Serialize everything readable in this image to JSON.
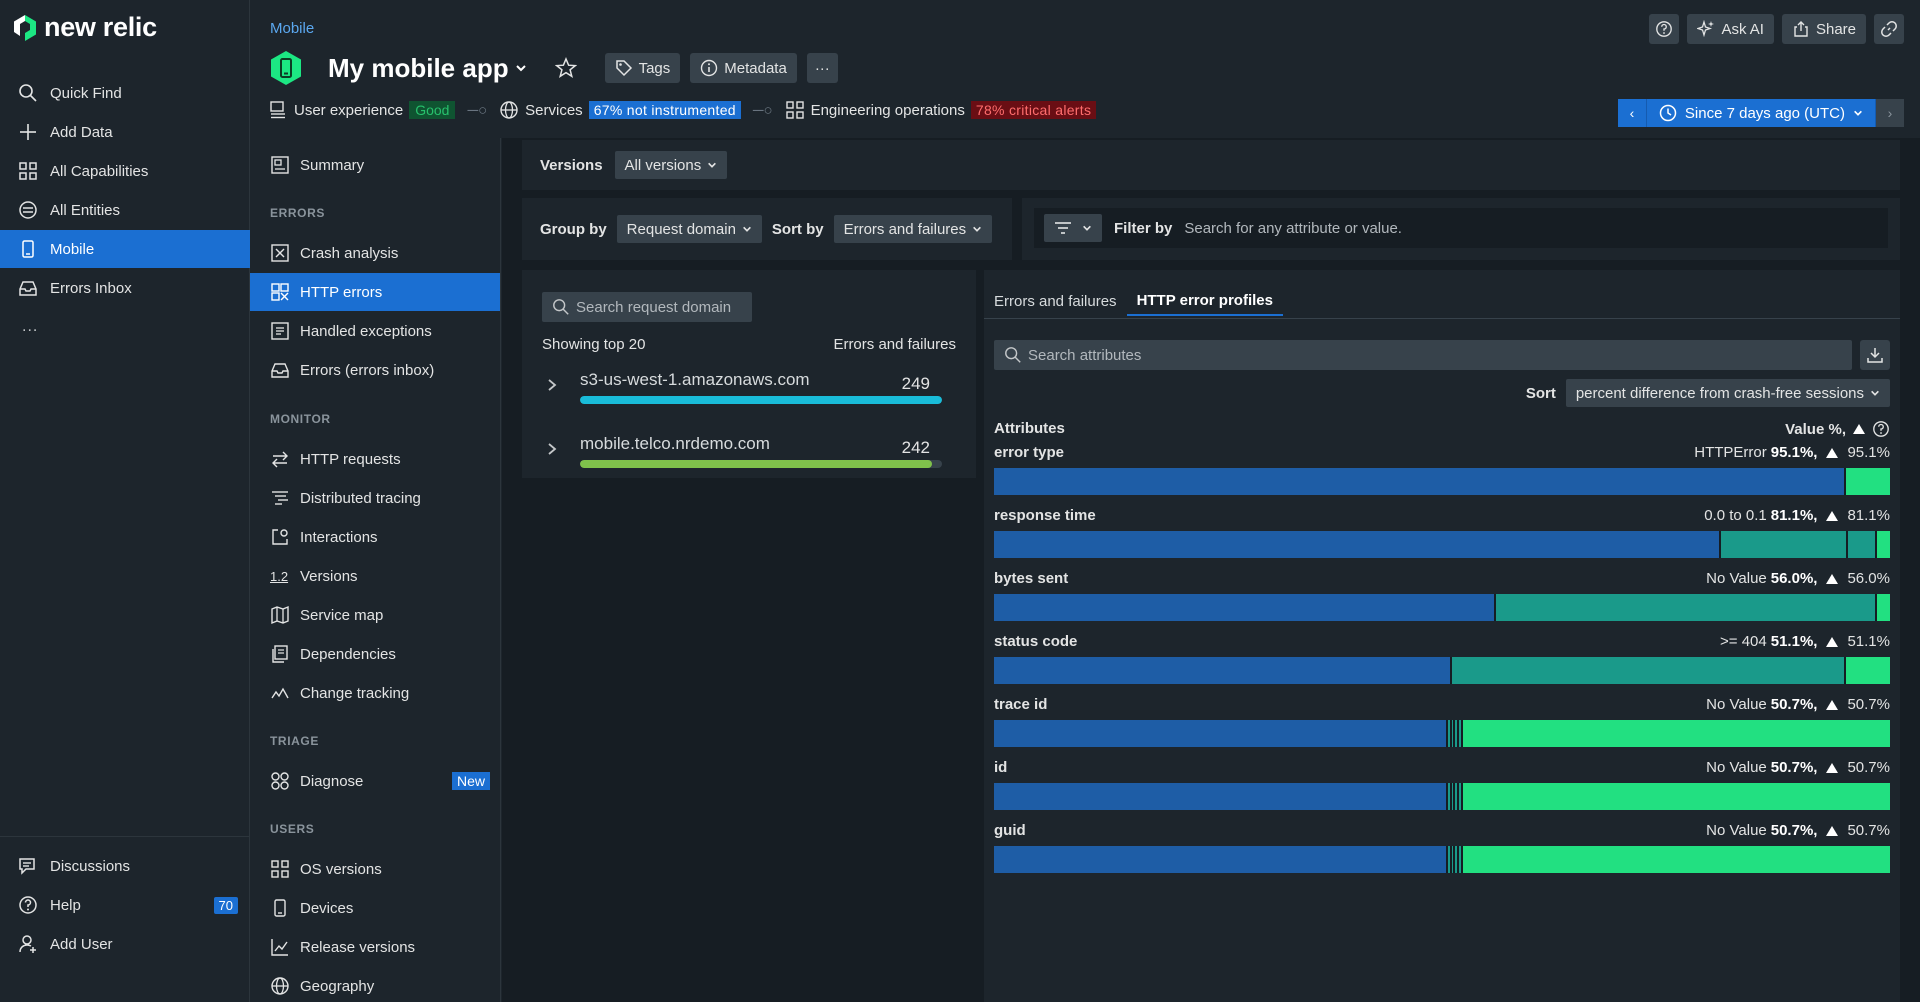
{
  "brand": {
    "name": "new relic"
  },
  "leftnav": {
    "items": [
      {
        "label": "Quick Find",
        "icon": "search-icon"
      },
      {
        "label": "Add Data",
        "icon": "plus-icon"
      },
      {
        "label": "All Capabilities",
        "icon": "grid-icon"
      },
      {
        "label": "All Entities",
        "icon": "entities-icon"
      },
      {
        "label": "Mobile",
        "icon": "mobile-icon"
      },
      {
        "label": "Errors Inbox",
        "icon": "inbox-icon"
      }
    ],
    "more": "...",
    "bottom": [
      {
        "label": "Discussions",
        "icon": "discussions-icon"
      },
      {
        "label": "Help",
        "icon": "help-icon",
        "count": "70"
      },
      {
        "label": "Add User",
        "icon": "add-user-icon"
      }
    ]
  },
  "header": {
    "breadcrumb": "Mobile",
    "title": "My mobile app",
    "tags_label": "Tags",
    "metadata_label": "Metadata",
    "more_label": "···",
    "ask_ai_label": "Ask AI",
    "share_label": "Share"
  },
  "status": {
    "user_experience": {
      "label": "User experience",
      "value": "Good"
    },
    "services": {
      "label": "Services",
      "value": "67% not instrumented"
    },
    "engineering": {
      "label": "Engineering operations",
      "value": "78% critical alerts"
    }
  },
  "time_picker": {
    "label": "Since 7 days ago (UTC)"
  },
  "subnav": {
    "summary": "Summary",
    "sections": [
      {
        "heading": "ERRORS",
        "items": [
          "Crash analysis",
          "HTTP errors",
          "Handled exceptions",
          "Errors (errors inbox)"
        ]
      },
      {
        "heading": "MONITOR",
        "items": [
          "HTTP requests",
          "Distributed tracing",
          "Interactions",
          "Versions",
          "Service map",
          "Dependencies",
          "Change tracking"
        ]
      },
      {
        "heading": "TRIAGE",
        "items": [
          "Diagnose"
        ]
      },
      {
        "heading": "USERS",
        "items": [
          "OS versions",
          "Devices",
          "Release versions",
          "Geography"
        ]
      }
    ],
    "new_badge": "New"
  },
  "versions_bar": {
    "label": "Versions",
    "value": "All versions"
  },
  "controls": {
    "group_by_label": "Group by",
    "group_by_value": "Request domain",
    "sort_by_label": "Sort by",
    "sort_by_value": "Errors and failures",
    "filter_label": "Filter by",
    "filter_placeholder": "Search for any attribute or value."
  },
  "domains": {
    "search_placeholder": "Search request domain",
    "showing": "Showing top 20",
    "column": "Errors and failures",
    "rows": [
      {
        "name": "s3-us-west-1.amazonaws.com",
        "value": "249",
        "fraction": 1.0,
        "color": "#19bcd9"
      },
      {
        "name": "mobile.telco.nrdemo.com",
        "value": "242",
        "fraction": 0.972,
        "color": "#7fc14b"
      }
    ]
  },
  "profiles": {
    "tabs": [
      "Errors and failures",
      "HTTP error profiles"
    ],
    "search_placeholder": "Search attributes",
    "sort_label": "Sort",
    "sort_value": "percent difference from crash-free sessions",
    "attributes_header": "Attributes",
    "value_header": "Value %,",
    "rows": [
      {
        "name": "error type",
        "value": "HTTPError",
        "pct": "95.1%,",
        "delta": "95.1%",
        "segments": [
          0.951,
          0.049
        ]
      },
      {
        "name": "response time",
        "value": "0.0 to 0.1",
        "pct": "81.1%,",
        "delta": "81.1%",
        "segments": [
          0.811,
          0.142,
          0.033,
          0.014
        ]
      },
      {
        "name": "bytes sent",
        "value": "No Value",
        "pct": "56.0%,",
        "delta": "56.0%",
        "segments": [
          0.56,
          0.425,
          0.015
        ]
      },
      {
        "name": "status code",
        "value": ">= 404",
        "pct": "51.1%,",
        "delta": "51.1%",
        "segments": [
          0.511,
          0.44,
          0.049
        ]
      },
      {
        "name": "trace id",
        "value": "No Value",
        "pct": "50.7%,",
        "delta": "50.7%",
        "segments": [
          0.507,
          0.004,
          0.004,
          0.004,
          0.004,
          0.477
        ]
      },
      {
        "name": "id",
        "value": "No Value",
        "pct": "50.7%,",
        "delta": "50.7%",
        "segments": [
          0.507,
          0.004,
          0.004,
          0.004,
          0.004,
          0.477
        ]
      },
      {
        "name": "guid",
        "value": "No Value",
        "pct": "50.7%,",
        "delta": "50.7%",
        "segments": [
          0.507,
          0.004,
          0.004,
          0.004,
          0.004,
          0.477
        ]
      }
    ]
  }
}
